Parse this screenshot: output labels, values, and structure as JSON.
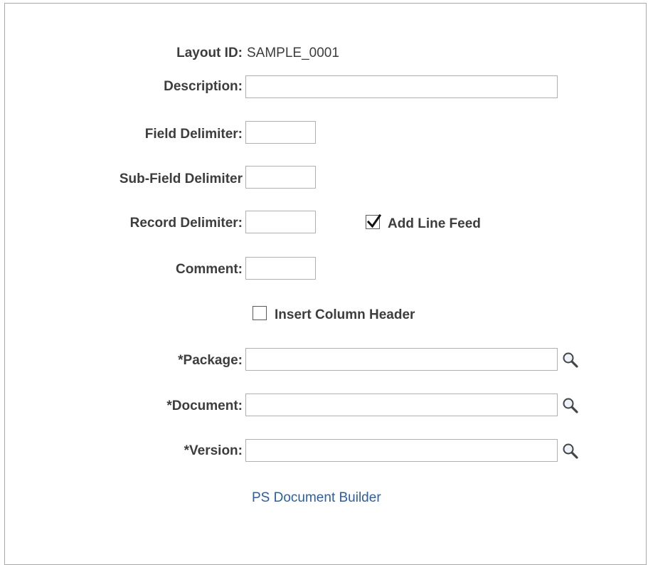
{
  "form": {
    "layout_id": {
      "label": "Layout ID:",
      "value": "SAMPLE_0001"
    },
    "description": {
      "label": "Description:",
      "value": ""
    },
    "field_delimiter": {
      "label": "Field Delimiter:",
      "value": ""
    },
    "sub_field_delimiter": {
      "label": "Sub-Field Delimiter",
      "value": ""
    },
    "record_delimiter": {
      "label": "Record Delimiter:",
      "value": ""
    },
    "add_line_feed": {
      "label": "Add Line Feed",
      "checked": true
    },
    "comment": {
      "label": "Comment:",
      "value": ""
    },
    "insert_column_header": {
      "label": "Insert Column Header",
      "checked": false
    },
    "package": {
      "label": "*Package:",
      "value": ""
    },
    "document": {
      "label": "*Document:",
      "value": ""
    },
    "version": {
      "label": "*Version:",
      "value": ""
    }
  },
  "links": {
    "ps_document_builder": "PS Document Builder"
  },
  "icons": {
    "lookup": "magnifying-glass-icon",
    "check": "checkmark-icon"
  },
  "colors": {
    "label_text": "#3d3d3d",
    "link": "#2a5ea6",
    "input_border": "#b0b0b0"
  }
}
